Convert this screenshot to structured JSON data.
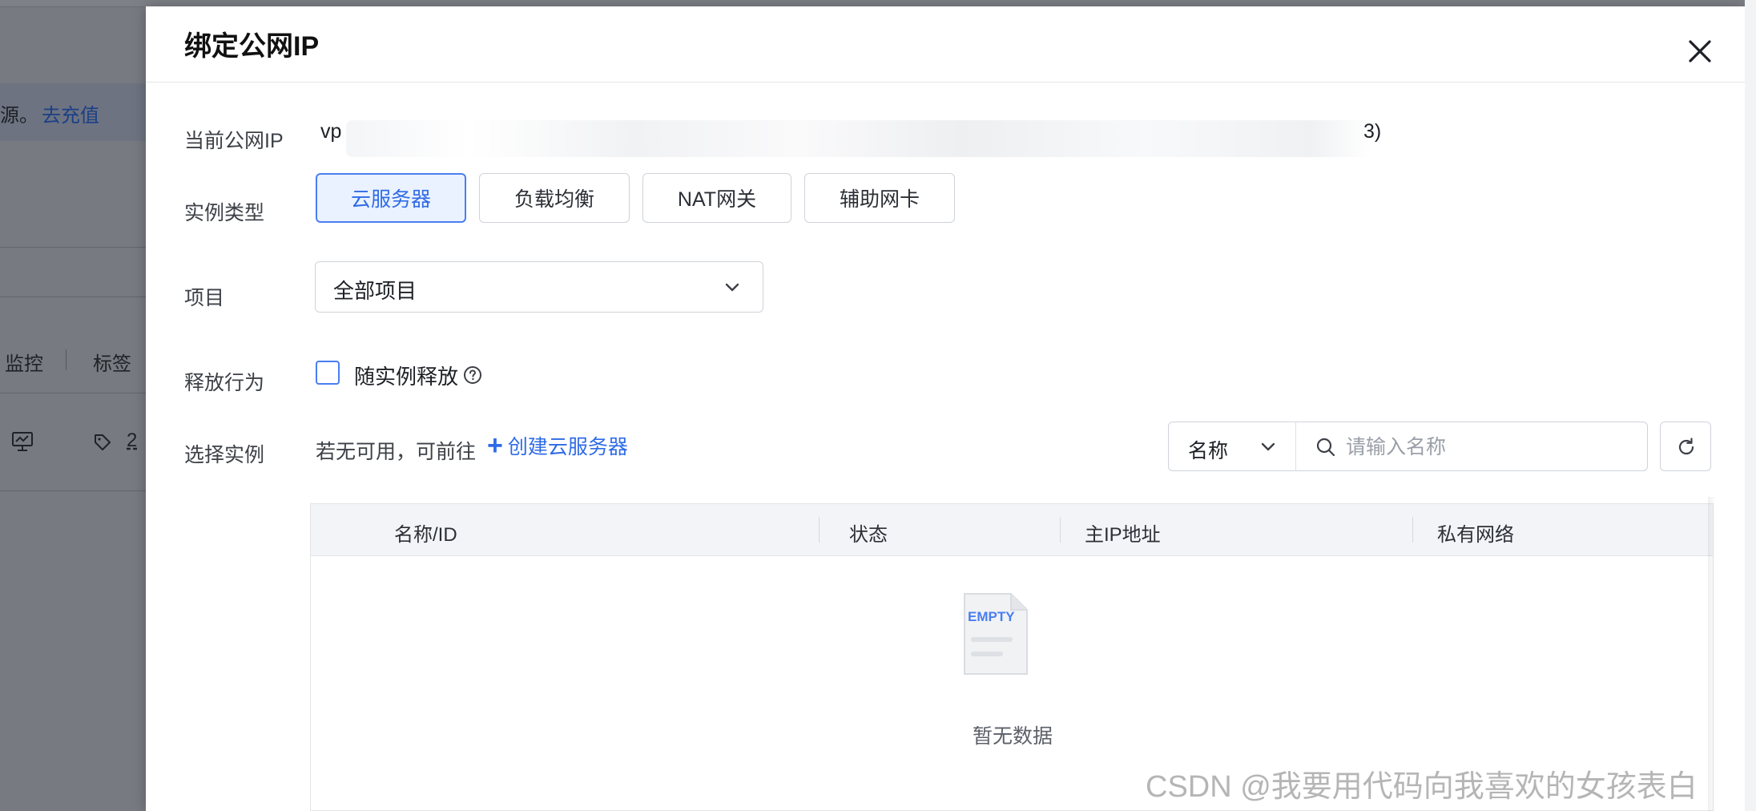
{
  "background": {
    "notice_text": "源。",
    "notice_link": "去充值",
    "columns": [
      "监控",
      "标签"
    ],
    "tag_count": "2",
    "icons": [
      "monitor-icon",
      "tag-icon"
    ]
  },
  "modal": {
    "title": "绑定公网IP",
    "close_icon": "close-icon",
    "current_ip": {
      "label": "当前公网IP",
      "value_visible_prefix": "vp",
      "value_visible_suffix": "3)"
    },
    "instance_type": {
      "label": "实例类型",
      "options": [
        "云服务器",
        "负载均衡",
        "NAT网关",
        "辅助网卡"
      ],
      "selected": "云服务器"
    },
    "project": {
      "label": "项目",
      "selected": "全部项目"
    },
    "release": {
      "label": "释放行为",
      "checkbox_label": "随实例释放",
      "checked": false
    },
    "select_instance": {
      "label": "选择实例",
      "hint": "若无可用，可前往",
      "create_link": "创建云服务器",
      "filter_field": "名称",
      "search_placeholder": "请输入名称"
    },
    "table": {
      "columns": [
        "名称/ID",
        "状态",
        "主IP地址",
        "私有网络"
      ],
      "empty_badge": "EMPTY",
      "empty_text": "暂无数据"
    }
  },
  "watermark": "CSDN @我要用代码向我喜欢的女孩表白",
  "colors": {
    "accent": "#2f6be6",
    "accent_bg": "#ebf2ff",
    "overlay": "#777a80"
  }
}
